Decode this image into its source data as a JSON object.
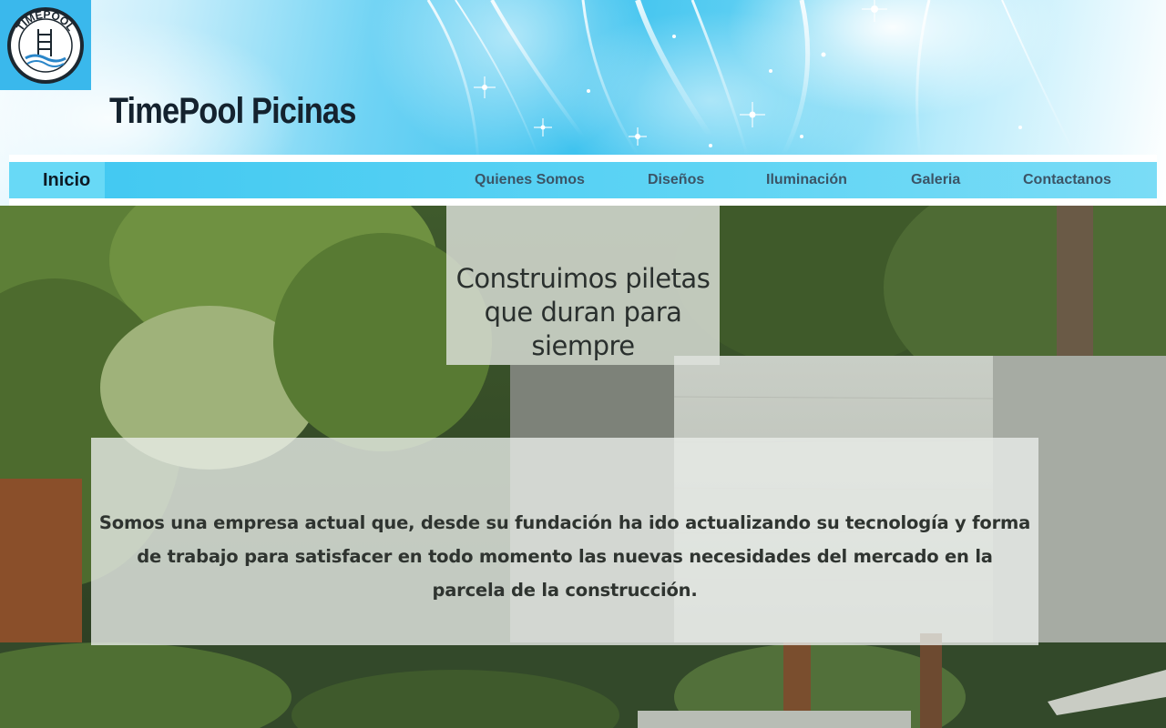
{
  "header": {
    "site_title": "TimePool Picinas",
    "logo_text": "TIMEPOOL"
  },
  "nav": {
    "items": [
      {
        "label": "Inicio",
        "active": true
      },
      {
        "label": "Quienes Somos",
        "active": false
      },
      {
        "label": "Diseños",
        "active": false
      },
      {
        "label": "Iluminación",
        "active": false
      },
      {
        "label": "Galeria",
        "active": false
      },
      {
        "label": "Contactanos",
        "active": false
      }
    ]
  },
  "hero": {
    "tagline": "Construimos piletas que duran para siempre",
    "about": "Somos una empresa actual que, desde su fundación ha ido actualizando su tecnología y forma de trabajo para satisfacer en todo momento las nuevas necesidades del mercado en la parcela de la construcción."
  },
  "colors": {
    "nav_bar": "#4fcdf2",
    "nav_active": "#68d9f6",
    "title": "#14222e",
    "logo_bg": "#3ab8ec"
  }
}
